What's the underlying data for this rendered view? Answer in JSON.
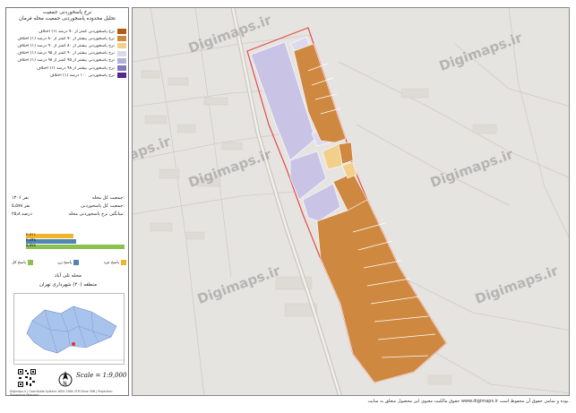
{
  "panel": {
    "title_line1": "نرخ پاسخوردنی جمعیت",
    "title_line2": "تحلیل محدوده پاسخوردنی جمعیت محله فرمان"
  },
  "legend": [
    {
      "label": "نرخ پاسخوردنی کمتر از ۷۰ درصد (۱) اختلاف",
      "color": "#b25b13"
    },
    {
      "label": "نرخ پاسخوردنی بیشتر از ۷۰ کمتر از ۸۰ درصد (۱) اختلاف",
      "color": "#cf883f"
    },
    {
      "label": "نرخ پاسخوردنی بیشتر از ۸۰ کمتر از ۹۰ درصد (۱) اختلاف",
      "color": "#f3cf8c"
    },
    {
      "label": "نرخ پاسخوردنی بیشتر از ۹۰ کمتر از ۹۵ درصد (۱) اختلاف",
      "color": "#d9d9ec"
    },
    {
      "label": "نرخ پاسخوردنی بیشتر از ۹۵ کمتر از ۹۸ درصد (۱) اختلاف",
      "color": "#b3b0da"
    },
    {
      "label": "نرخ پاسخوردنی بیشتر از ۹۸ درصد (۱) اختلاف",
      "color": "#8178b6"
    },
    {
      "label": "نرخ پاسخوردنی ۱۰۰ درصد (۱) اختلاف",
      "color": "#54278f"
    }
  ],
  "stats": [
    {
      "label": "جمعیت کل محله:",
      "value": "۱۳۰۶ نفر"
    },
    {
      "label": "جمعیت کل پاسخوردنی:",
      "value": "۵,۵۷۸ نفر"
    },
    {
      "label": "میانگین نرخ پاسخوردنی محله:",
      "value": "۲۵٫۸ درصد"
    }
  ],
  "bars": [
    {
      "label": "۲,۷۱۱",
      "value": 2711,
      "color": "#f0b429"
    },
    {
      "label": "۲,۸۴۸",
      "value": 2848,
      "color": "#4f86b3"
    },
    {
      "label": "۵,۵۷۸",
      "value": 5578,
      "color": "#8cc152"
    }
  ],
  "categories": [
    {
      "label": "پاسخ کل",
      "color": "#8cc152"
    },
    {
      "label": "پاسخ زن",
      "color": "#4f86b3"
    },
    {
      "label": "پاسخ مرد",
      "color": "#f0b429"
    }
  ],
  "subtitle1": "محله تلی آباد",
  "subtitle2": "منطقه (۲۰) شهرداری تهران",
  "scale": "Scale = 1:9,000",
  "panel_footer": "Digimaps.ir | Coordinate System: WGS 1984 UTM Zone 39N | Projection: Transverse Mercator",
  "watermark": "Digimaps.ir",
  "watermark_short": "maps.ir",
  "footer": "حقوق مالکیت معنوی این محصول متعلق به سایت www.digimaps.ir بوده و تمامی حقوق آن محفوظ است."
}
